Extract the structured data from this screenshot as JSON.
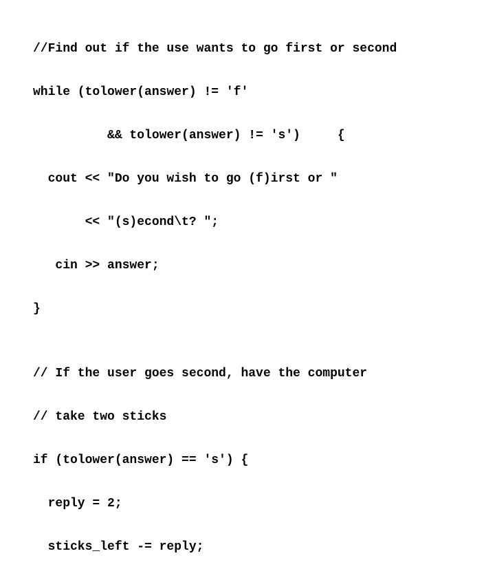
{
  "code": {
    "lines": [
      "//Find out if the use wants to go first or second",
      "while (tolower(answer) != 'f'",
      "          && tolower(answer) != 's')     {",
      "  cout << \"Do you wish to go (f)irst or \"",
      "       << \"(s)econd\\t? \";",
      "   cin >> answer;",
      "}",
      "",
      "// If the user goes second, have the computer",
      "// take two sticks",
      "if (tolower(answer) == 's') {",
      "  reply = 2;",
      "  sticks_left -= reply;"
    ]
  }
}
